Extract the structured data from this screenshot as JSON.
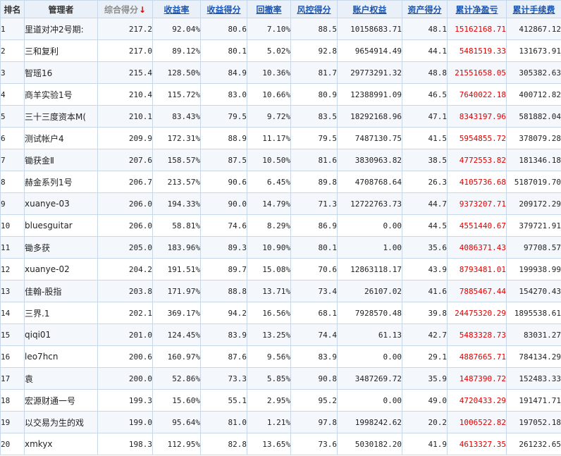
{
  "columns": [
    {
      "label": "排名",
      "style": "plain"
    },
    {
      "label": "管理者",
      "style": "plain"
    },
    {
      "label": "综合得分",
      "style": "sorted"
    },
    {
      "label": "收益率",
      "style": "link"
    },
    {
      "label": "收益得分",
      "style": "link"
    },
    {
      "label": "回撤率",
      "style": "link"
    },
    {
      "label": "风控得分",
      "style": "link"
    },
    {
      "label": "账户权益",
      "style": "link"
    },
    {
      "label": "资产得分",
      "style": "link"
    },
    {
      "label": "累计净盈亏",
      "style": "link"
    },
    {
      "label": "累计手续费",
      "style": "link"
    }
  ],
  "sort_indicator": "↓",
  "rows": [
    [
      "1",
      "里道对冲2号期:",
      "217.2",
      "92.04%",
      "80.6",
      "7.10%",
      "88.5",
      "10158683.71",
      "48.1",
      "15162168.71",
      "412867.12"
    ],
    [
      "2",
      "三和复利",
      "217.0",
      "89.12%",
      "80.1",
      "5.02%",
      "92.8",
      "9654914.49",
      "44.1",
      "5481519.33",
      "131673.91"
    ],
    [
      "3",
      "智瑶16",
      "215.4",
      "128.50%",
      "84.9",
      "10.36%",
      "81.7",
      "29773291.32",
      "48.8",
      "21551658.05",
      "305382.63"
    ],
    [
      "4",
      "商羊实验1号",
      "210.4",
      "115.72%",
      "83.0",
      "10.66%",
      "80.9",
      "12388991.09",
      "46.5",
      "7640022.18",
      "400712.82"
    ],
    [
      "5",
      "三十三度资本M(",
      "210.1",
      "83.43%",
      "79.5",
      "9.72%",
      "83.5",
      "18292168.96",
      "47.1",
      "8343197.96",
      "581882.04"
    ],
    [
      "6",
      "测试帐户4",
      "209.9",
      "172.31%",
      "88.9",
      "11.17%",
      "79.5",
      "7487130.75",
      "41.5",
      "5954855.72",
      "378079.28"
    ],
    [
      "7",
      "锄获金Ⅱ",
      "207.6",
      "158.57%",
      "87.5",
      "10.50%",
      "81.6",
      "3830963.82",
      "38.5",
      "4772553.82",
      "181346.18"
    ],
    [
      "8",
      "赫金系列1号",
      "206.7",
      "213.57%",
      "90.6",
      "6.45%",
      "89.8",
      "4708768.64",
      "26.3",
      "4105736.68",
      "5187019.70"
    ],
    [
      "9",
      "xuanye-03",
      "206.0",
      "194.33%",
      "90.0",
      "14.79%",
      "71.3",
      "12722763.73",
      "44.7",
      "9373207.71",
      "209172.29"
    ],
    [
      "10",
      "bluesguitar",
      "206.0",
      "58.81%",
      "74.6",
      "8.29%",
      "86.9",
      "0.00",
      "44.5",
      "4551440.67",
      "379721.91"
    ],
    [
      "11",
      "锄多获",
      "205.0",
      "183.96%",
      "89.3",
      "10.90%",
      "80.1",
      "1.00",
      "35.6",
      "4086371.43",
      "97708.57"
    ],
    [
      "12",
      "xuanye-02",
      "204.2",
      "191.51%",
      "89.7",
      "15.08%",
      "70.6",
      "12863118.17",
      "43.9",
      "8793481.01",
      "199938.99"
    ],
    [
      "13",
      "佳翰-股指",
      "203.8",
      "171.97%",
      "88.8",
      "13.71%",
      "73.4",
      "26107.02",
      "41.6",
      "7885467.44",
      "154270.43"
    ],
    [
      "14",
      "三界.1",
      "202.1",
      "369.17%",
      "94.2",
      "16.56%",
      "68.1",
      "7928570.48",
      "39.8",
      "24475320.29",
      "1895538.61"
    ],
    [
      "15",
      "qiqi01",
      "201.0",
      "124.45%",
      "83.9",
      "13.25%",
      "74.4",
      "61.13",
      "42.7",
      "5483328.73",
      "83031.27"
    ],
    [
      "16",
      "leo7hcn",
      "200.6",
      "160.97%",
      "87.6",
      "9.56%",
      "83.9",
      "0.00",
      "29.1",
      "4887665.71",
      "784134.29"
    ],
    [
      "17",
      "袁",
      "200.0",
      "52.86%",
      "73.3",
      "5.85%",
      "90.8",
      "3487269.72",
      "35.9",
      "1487390.72",
      "152483.33"
    ],
    [
      "18",
      "宏源财通一号",
      "199.3",
      "15.60%",
      "55.1",
      "2.95%",
      "95.2",
      "0.00",
      "49.0",
      "4720433.29",
      "191471.71"
    ],
    [
      "19",
      "以交易为生的戏",
      "199.0",
      "95.64%",
      "81.0",
      "1.21%",
      "97.8",
      "1998242.62",
      "20.2",
      "1006522.82",
      "197052.18"
    ],
    [
      "20",
      "xmkyx",
      "198.3",
      "112.95%",
      "82.8",
      "13.65%",
      "73.6",
      "5030182.20",
      "41.9",
      "4613327.35",
      "261232.65"
    ]
  ],
  "colors": {
    "header_link": "#1a55b3",
    "header_sorted": "#8c8c8c",
    "net_profit": "#e00000",
    "border": "#c9d8e8",
    "header_bg": "#eaf0f7",
    "row_alt": "#f4f7fb"
  }
}
